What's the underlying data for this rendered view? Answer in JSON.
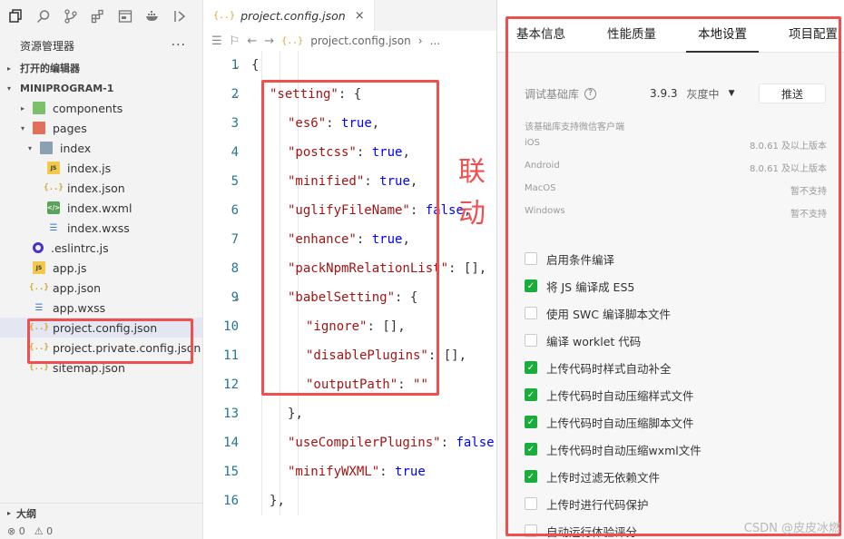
{
  "sidebar": {
    "activity_icons": [
      "copy-icon",
      "search-icon",
      "source-control-icon",
      "extensions-icon",
      "preview-icon",
      "docker-icon",
      "debug-icon"
    ],
    "explorer_title": "资源管理器",
    "more": "···",
    "open_editors": "打开的编辑器",
    "project_root": "MINIPROGRAM-1",
    "tree": [
      {
        "label": "components",
        "icon": "folder-icon",
        "twisty": "▸"
      },
      {
        "label": "pages",
        "icon": "folder-icon",
        "twisty": "▾"
      },
      {
        "label": "index",
        "icon": "folder-icon",
        "twisty": "▾"
      },
      {
        "label": "index.js",
        "icon": "js-file-icon",
        "badge": "JS"
      },
      {
        "label": "index.json",
        "icon": "json-file-icon",
        "badge": "{..}"
      },
      {
        "label": "index.wxml",
        "icon": "wxml-file-icon",
        "badge": "</>"
      },
      {
        "label": "index.wxss",
        "icon": "wxss-file-icon",
        "badge": "☰"
      },
      {
        "label": ".eslintrc.js",
        "icon": "eslint-file-icon"
      },
      {
        "label": "app.js",
        "icon": "js-file-icon",
        "badge": "JS"
      },
      {
        "label": "app.json",
        "icon": "json-file-icon",
        "badge": "{..}"
      },
      {
        "label": "app.wxss",
        "icon": "wxss-file-icon",
        "badge": "☰"
      },
      {
        "label": "project.config.json",
        "icon": "json-file-icon",
        "badge": "{..}"
      },
      {
        "label": "project.private.config.json",
        "icon": "json-file-icon",
        "badge": "{..}"
      },
      {
        "label": "sitemap.json",
        "icon": "json-file-icon",
        "badge": "{..}"
      }
    ],
    "outline": "大纲",
    "status": {
      "errors": "0",
      "warnings": "0"
    }
  },
  "editor": {
    "tab_icon": "{..}",
    "tab_label": "project.config.json",
    "tab_close": "×",
    "breadcrumb_file": "project.config.json",
    "breadcrumb_more": "...",
    "breadcrumb_sep": "›",
    "annotation": [
      "联",
      "动"
    ],
    "lines": [
      {
        "n": "1",
        "t": "{"
      },
      {
        "n": "2",
        "t": "\"setting\": {"
      },
      {
        "n": "3",
        "t": "\"es6\": true,"
      },
      {
        "n": "4",
        "t": "\"postcss\": true,"
      },
      {
        "n": "5",
        "t": "\"minified\": true,"
      },
      {
        "n": "6",
        "t": "\"uglifyFileName\": false,"
      },
      {
        "n": "7",
        "t": "\"enhance\": true,"
      },
      {
        "n": "8",
        "t": "\"packNpmRelationList\": [],"
      },
      {
        "n": "9",
        "t": "\"babelSetting\": {"
      },
      {
        "n": "10",
        "t": "\"ignore\": [],"
      },
      {
        "n": "11",
        "t": "\"disablePlugins\": [],"
      },
      {
        "n": "12",
        "t": "\"outputPath\": \"\""
      },
      {
        "n": "13",
        "t": "},"
      },
      {
        "n": "14",
        "t": "\"useCompilerPlugins\": false,"
      },
      {
        "n": "15",
        "t": "\"minifyWXML\": true"
      },
      {
        "n": "16",
        "t": "},"
      }
    ]
  },
  "panel": {
    "tabs": [
      "基本信息",
      "性能质量",
      "本地设置",
      "项目配置"
    ],
    "active_tab": "本地设置",
    "lib_label": "调试基础库",
    "lib_version": "3.9.3",
    "lib_channel": "灰度中",
    "push": "推送",
    "support_note": "该基础库支持微信客户端",
    "clients": [
      {
        "os": "iOS",
        "support": "8.0.61 及以上版本"
      },
      {
        "os": "Android",
        "support": "8.0.61 及以上版本"
      },
      {
        "os": "MacOS",
        "support": "暂不支持"
      },
      {
        "os": "Windows",
        "support": "暂不支持"
      }
    ],
    "options": [
      {
        "label": "启用条件编译",
        "checked": false
      },
      {
        "label": "将 JS 编译成 ES5",
        "checked": true
      },
      {
        "label": "使用 SWC 编译脚本文件",
        "checked": false
      },
      {
        "label": "编译 worklet 代码",
        "checked": false
      },
      {
        "label": "上传代码时样式自动补全",
        "checked": true
      },
      {
        "label": "上传代码时自动压缩样式文件",
        "checked": true
      },
      {
        "label": "上传代码时自动压缩脚本文件",
        "checked": true
      },
      {
        "label": "上传代码时自动压缩wxml文件",
        "checked": true
      },
      {
        "label": "上传时过滤无依赖文件",
        "checked": true
      },
      {
        "label": "上传时进行代码保护",
        "checked": false
      },
      {
        "label": "自动运行体验评分",
        "checked": false
      }
    ],
    "watermark": "CSDN @皮皮冰燃"
  },
  "colors": {
    "highlight_box": "#ef4f4f",
    "checkbox_checked": "#1aad3c",
    "json_key": "#a31515",
    "json_bool": "#0000ff"
  }
}
